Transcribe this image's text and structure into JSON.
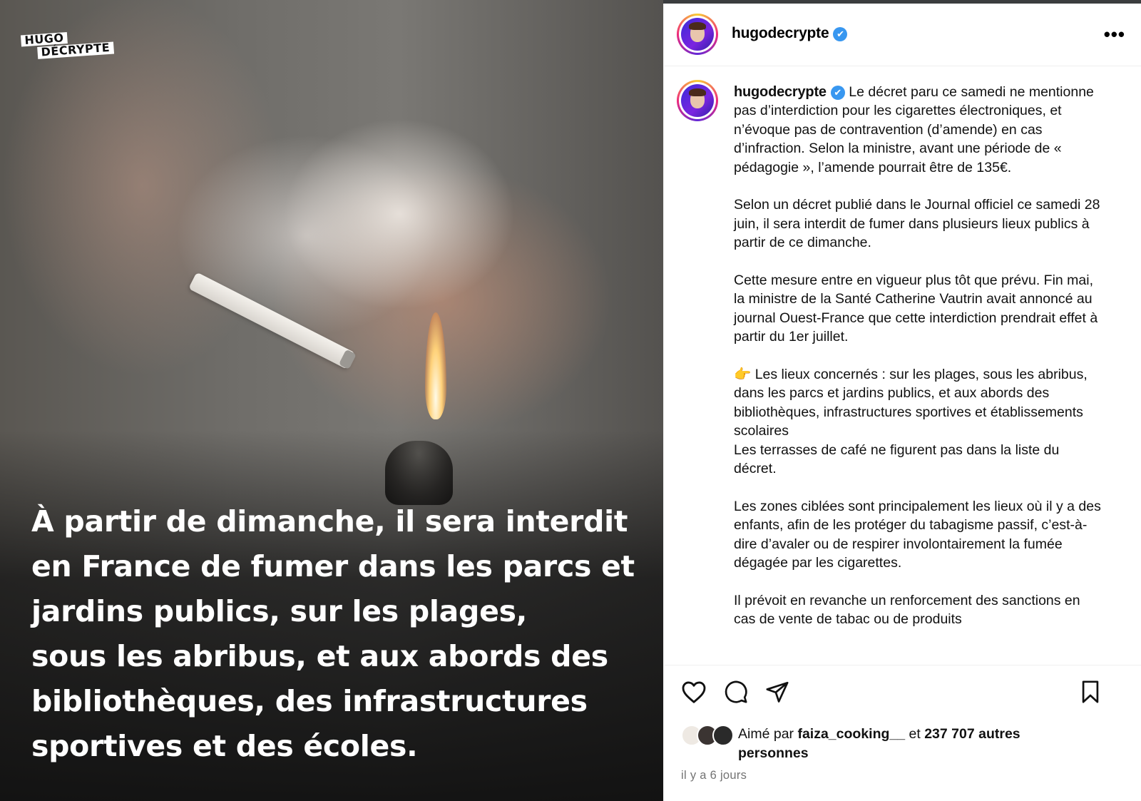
{
  "post": {
    "brand_logo_line1": "HUGO",
    "brand_logo_line2": "DÉCRYPTE",
    "image_text_lines": [
      "À partir de dimanche, il sera interdit",
      "en France de fumer dans les parcs et",
      "jardins publics, sur les plages,",
      "sous les abribus, et aux abords des",
      "bibliothèques, des infrastructures",
      "sportives et des écoles."
    ]
  },
  "header": {
    "username": "hugodecrypte",
    "verified_icon": "✔",
    "more_icon": "•••"
  },
  "caption": {
    "username": "hugodecrypte",
    "first_paragraph": "Le décret paru ce samedi ne mentionne pas d’interdiction pour les cigarettes électroniques, et n’évoque pas de contravention (d’amende) en cas d’infraction. Selon la ministre, avant une période de « pédagogie », l’amende pourrait être de 135€.",
    "paragraph_2": "Selon un décret publié dans le Journal officiel ce samedi 28 juin, il sera interdit de fumer dans plusieurs lieux publics à partir de ce dimanche.",
    "paragraph_3": "Cette mesure entre en vigueur plus tôt que prévu. Fin mai, la ministre de la Santé Catherine Vautrin avait annoncé au journal Ouest-France que cette interdiction prendrait effet à partir du 1er juillet.",
    "paragraph_4_line1": "👉 Les lieux concernés : sur les plages, sous les abribus, dans les parcs et jardins publics, et aux abords des bibliothèques, infrastructures sportives et établissements scolaires",
    "paragraph_4_line2": "Les terrasses de café ne figurent pas dans la liste du décret.",
    "paragraph_5": "Les zones ciblées sont principalement les lieux où il y a des enfants, afin de les protéger du tabagisme passif, c’est-à-dire d’avaler ou de respirer involontairement la fumée dégagée par les cigarettes.",
    "paragraph_6": "Il prévoit en revanche un renforcement des sanctions en cas de vente de tabac ou de produits"
  },
  "likes": {
    "prefix": "Aimé par",
    "user": "faiza_cooking__",
    "middle": "et",
    "count": "237 707 autres personnes"
  },
  "timestamp": "il y a 6 jours",
  "colors": {
    "verified": "#3897f0",
    "muted_text": "#737373",
    "divider": "#efefef"
  }
}
